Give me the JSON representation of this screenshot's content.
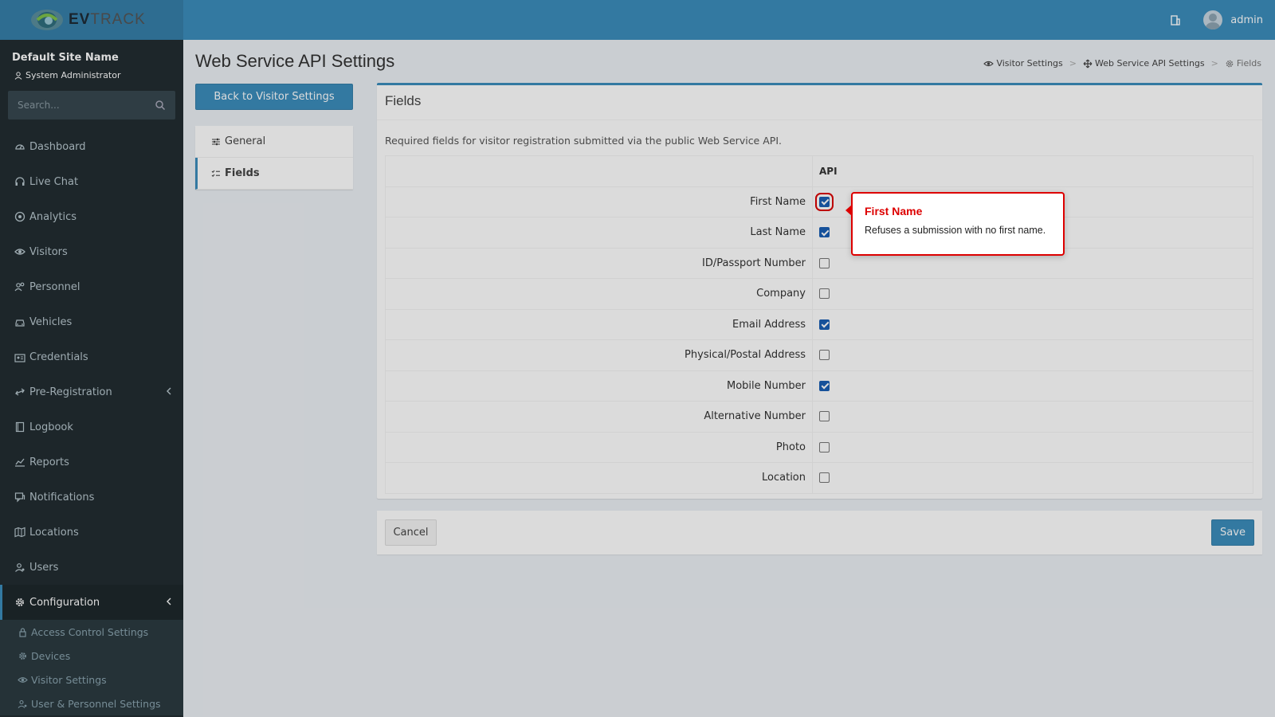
{
  "header": {
    "logo_prefix": "EV",
    "logo_suffix": "TRACK",
    "user_name": "admin"
  },
  "sidebar": {
    "site_name": "Default Site Name",
    "role": "System Administrator",
    "search_placeholder": "Search...",
    "items": [
      {
        "label": "Dashboard",
        "icon": "dashboard-icon"
      },
      {
        "label": "Live Chat",
        "icon": "headset-icon"
      },
      {
        "label": "Analytics",
        "icon": "target-icon"
      },
      {
        "label": "Visitors",
        "icon": "eye-icon"
      },
      {
        "label": "Personnel",
        "icon": "users-icon"
      },
      {
        "label": "Vehicles",
        "icon": "car-icon"
      },
      {
        "label": "Credentials",
        "icon": "id-card-icon"
      },
      {
        "label": "Pre-Registration",
        "icon": "exchange-icon"
      },
      {
        "label": "Logbook",
        "icon": "book-icon"
      },
      {
        "label": "Reports",
        "icon": "chart-icon"
      },
      {
        "label": "Notifications",
        "icon": "chat-icon"
      },
      {
        "label": "Locations",
        "icon": "map-icon"
      },
      {
        "label": "Users",
        "icon": "user-group-icon"
      },
      {
        "label": "Configuration",
        "icon": "gear-icon"
      }
    ],
    "subitems": [
      {
        "label": "Access Control Settings",
        "icon": "lock-icon"
      },
      {
        "label": "Devices",
        "icon": "cog-icon"
      },
      {
        "label": "Visitor Settings",
        "icon": "eye-icon"
      },
      {
        "label": "User & Personnel Settings",
        "icon": "users-icon"
      }
    ]
  },
  "page": {
    "title": "Web Service API Settings",
    "breadcrumb": [
      "Visitor Settings",
      "Web Service API Settings",
      "Fields"
    ],
    "back_button": "Back to Visitor Settings",
    "nav": [
      {
        "label": "General",
        "icon": "sliders-icon"
      },
      {
        "label": "Fields",
        "icon": "checklist-icon"
      }
    ]
  },
  "panel": {
    "title": "Fields",
    "description": "Required fields for visitor registration submitted via the public Web Service API.",
    "column_header": "API",
    "fields": [
      {
        "label": "First Name",
        "checked": true
      },
      {
        "label": "Last Name",
        "checked": true
      },
      {
        "label": "ID/Passport Number",
        "checked": false
      },
      {
        "label": "Company",
        "checked": false
      },
      {
        "label": "Email Address",
        "checked": true
      },
      {
        "label": "Physical/Postal Address",
        "checked": false
      },
      {
        "label": "Mobile Number",
        "checked": true
      },
      {
        "label": "Alternative Number",
        "checked": false
      },
      {
        "label": "Photo",
        "checked": false
      },
      {
        "label": "Location",
        "checked": false
      }
    ]
  },
  "footer": {
    "cancel": "Cancel",
    "save": "Save"
  },
  "tooltip": {
    "title": "First Name",
    "body": "Refuses a submission with no first name."
  },
  "colors": {
    "primary": "#3c8dbc",
    "sidebar_bg": "#222d32",
    "highlight": "#dd0000"
  }
}
